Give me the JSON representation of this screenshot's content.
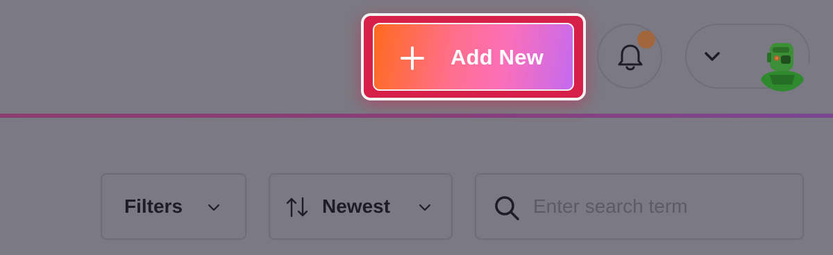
{
  "header": {
    "add_new_label": "Add New",
    "notification_indicator": true
  },
  "user_menu": {
    "avatar_icon": "robot-avatar",
    "dropdown_icon": "chevron-down-icon"
  },
  "toolbar": {
    "filters_label": "Filters",
    "sort_label": "Newest",
    "search": {
      "placeholder": "Enter search term",
      "value": ""
    }
  },
  "colors": {
    "accent_start": "#ff6a1e",
    "accent_mid": "#fb6fb8",
    "accent_end": "#c46af0",
    "highlight_border": "#d6204a",
    "notification_dot": "#a2663d",
    "overlay_background": "#7b7983"
  },
  "icons": [
    "plus-icon",
    "bell-icon",
    "chevron-down-icon",
    "sort-icon",
    "search-icon"
  ]
}
